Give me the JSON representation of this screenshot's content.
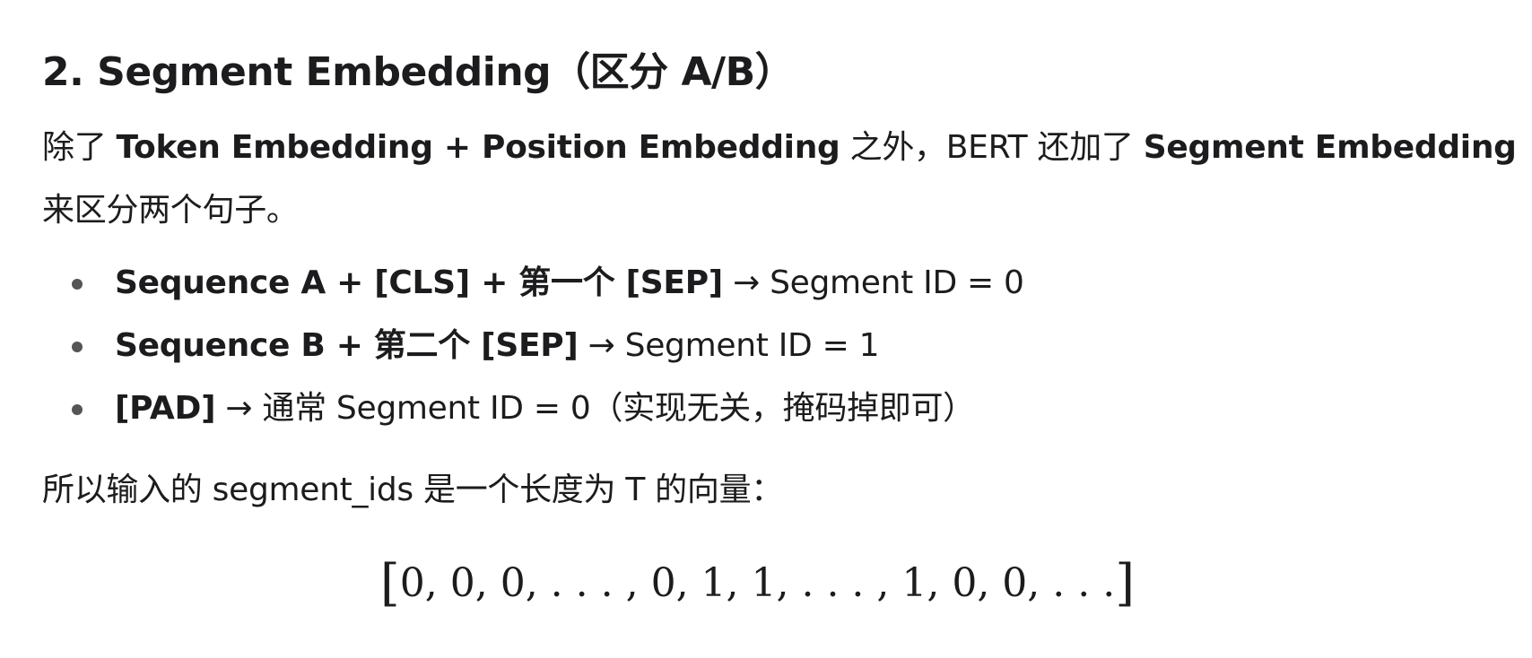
{
  "heading": "2. Segment Embedding（区分 A/B）",
  "intro": {
    "t1": "除了 ",
    "b1": "Token Embedding + Position Embedding",
    "t2": " 之外，BERT 还加了 ",
    "b2": "Segment Embedding",
    "t3": "来区分两个句子。"
  },
  "bullets": [
    {
      "bold": "Sequence A + [CLS] + 第一个 [SEP]",
      "rest": " → Segment ID = 0"
    },
    {
      "bold": "Sequence B + 第二个 [SEP]",
      "rest": " → Segment ID = 1"
    },
    {
      "bold": "[PAD]",
      "rest": " → 通常 Segment ID = 0（实现无关，掩码掉即可）"
    }
  ],
  "vector_intro": "所以输入的 segment_ids 是一个长度为 T 的向量：",
  "formula": {
    "open": "[",
    "body": "0, 0, 0, . . . , 0, 1, 1, . . . , 1, 0, 0, . . .",
    "close": "]"
  }
}
